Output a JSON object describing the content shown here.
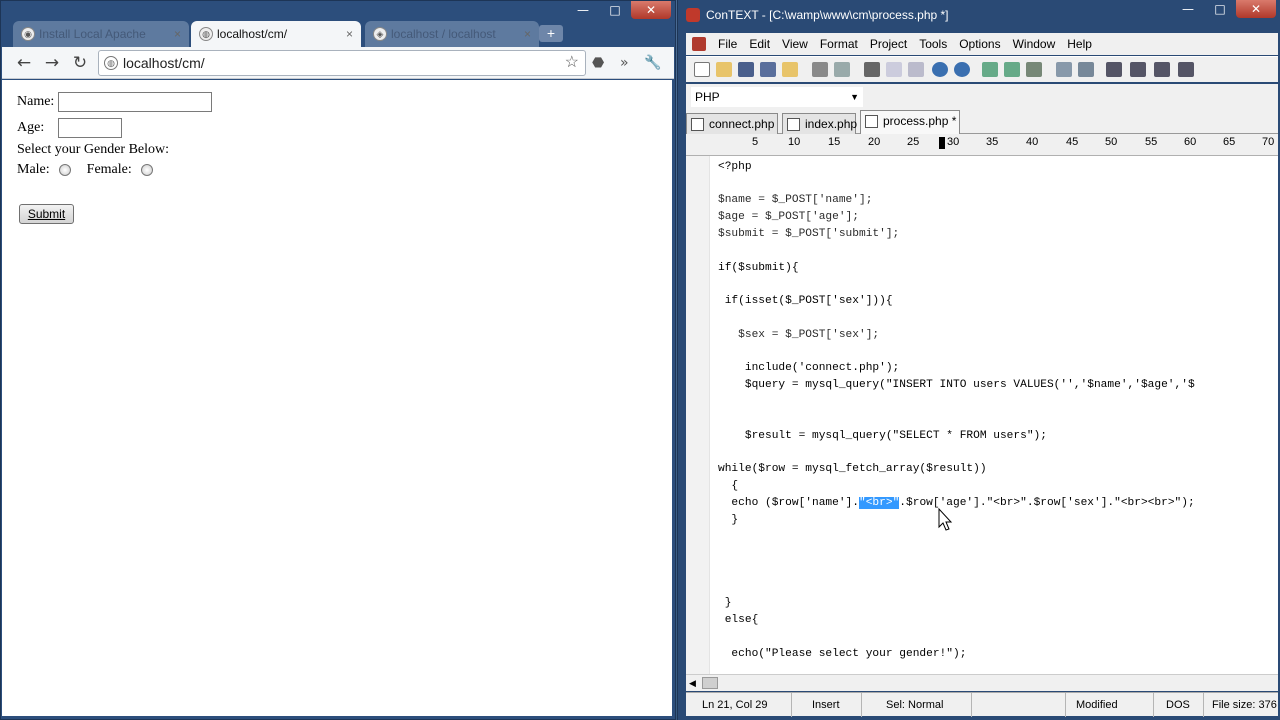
{
  "browser": {
    "tabs": [
      {
        "title": "Install Local Apache",
        "active": false
      },
      {
        "title": "localhost/cm/",
        "active": true
      },
      {
        "title": "localhost / localhost",
        "active": false
      }
    ],
    "close_glyph": "×",
    "new_tab_glyph": "+",
    "address": "localhost/cm/",
    "window_controls": {
      "minimize": "—",
      "maximize": "□",
      "close": "✕"
    }
  },
  "form": {
    "name_label": "Name:",
    "age_label": "Age:",
    "gender_prompt": "Select your Gender Below:",
    "male_label": "Male:",
    "female_label": "Female:",
    "submit_label": "Submit"
  },
  "editor_app": {
    "title": "ConTEXT - [C:\\wamp\\www\\cm\\process.php *]",
    "menu": [
      "File",
      "Edit",
      "View",
      "Format",
      "Project",
      "Tools",
      "Options",
      "Window",
      "Help"
    ],
    "language": "PHP",
    "file_tabs": [
      {
        "name": "connect.php",
        "active": false
      },
      {
        "name": "index.php",
        "active": false
      },
      {
        "name": "process.php *",
        "active": true
      }
    ],
    "ruler_numbers": [
      "5",
      "10",
      "15",
      "20",
      "25",
      "30",
      "35",
      "40",
      "45",
      "50",
      "55",
      "60",
      "65",
      "70"
    ],
    "code": {
      "l01": "<?php",
      "l03": "$name = $_POST['name'];",
      "l04": "$age = $_POST['age'];",
      "l05": "$submit = $_POST['submit'];",
      "l07": "if($submit){",
      "l09": " if(isset($_POST['sex'])){",
      "l11": "   $sex = $_POST['sex'];",
      "l13": "    include('connect.php');",
      "l14": "    $query = mysql_query(\"INSERT INTO users VALUES('','$name','$age','$",
      "l17": "    $result = mysql_query(\"SELECT * FROM users\");",
      "l19": "while($row = mysql_fetch_array($result))",
      "l20": "  {",
      "l21a": "  echo ($row['name'].",
      "l21sel": "\"<br>\"",
      "l21b": ".$row['age'].\"<br>\".$row['sex'].\"<br><br>\");",
      "l22": "  }",
      "l27": " }",
      "l28": " else{",
      "l30": "  echo(\"Please select your gender!\");"
    },
    "status": {
      "position": "Ln 21, Col 29",
      "mode": "Insert",
      "sel": "Sel: Normal",
      "modified": "Modified",
      "format": "DOS",
      "file_size": "File size: 376"
    }
  }
}
